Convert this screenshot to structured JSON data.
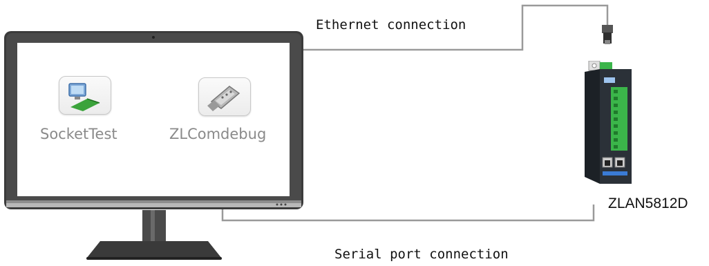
{
  "diagram": {
    "ethernet_label": "Ethernet connection",
    "serial_label": "Serial port connection",
    "device_label": "ZLAN5812D",
    "apps": [
      {
        "label": "SocketTest",
        "icon": "network-computer-icon"
      },
      {
        "label": "ZLComdebug",
        "icon": "serial-connector-icon"
      }
    ],
    "colors": {
      "cable": "#9a9a9a",
      "monitor_frame": "#3b3b3b",
      "device_body": "#2b3138",
      "terminal_green": "#3bb54a"
    }
  }
}
